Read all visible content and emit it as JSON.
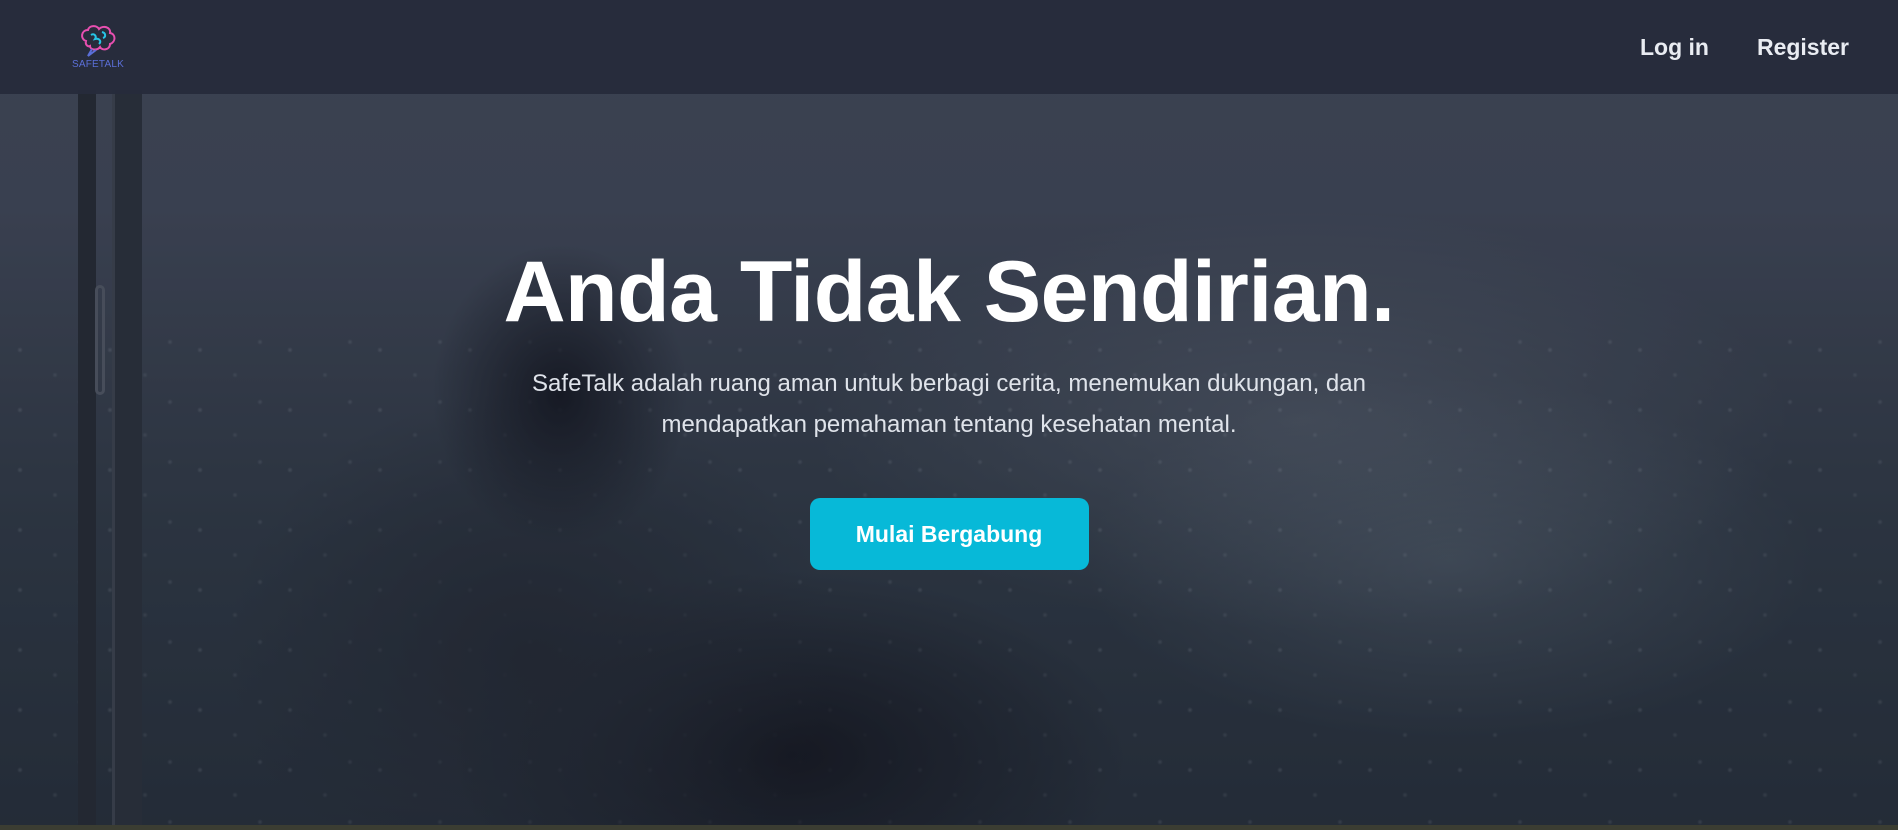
{
  "navbar": {
    "logo_text": "SAFETALK",
    "links": [
      {
        "label": "Log in"
      },
      {
        "label": "Register"
      }
    ]
  },
  "hero": {
    "headline": "Anda Tidak Sendirian.",
    "subtext": "SafeTalk adalah ruang aman untuk berbagi cerita, menemukan dukungan, dan mendapatkan pemahaman tentang kesehatan mental.",
    "cta_label": "Mulai Bergabung"
  },
  "colors": {
    "accent": "#07b9d8",
    "navbar_bg": "#262b3c",
    "logo_pink": "#e84fb0",
    "logo_cyan": "#27c4e6",
    "logo_blue": "#5b6fd8"
  },
  "icons": {
    "logo": "brain-chat-logo-icon"
  }
}
